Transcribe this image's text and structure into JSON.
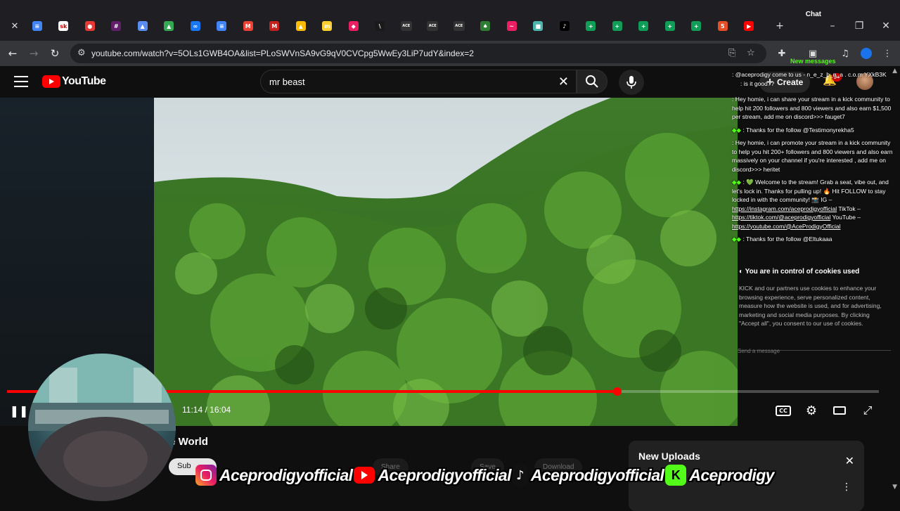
{
  "browser": {
    "chat_label": "Chat",
    "new_messages": "New messages",
    "url": "youtube.com/watch?v=5OLs1GWB4OA&list=PLoSWVnSA9vG9qV0CVCpg5WwEy3LiP7udY&index=2",
    "tabs": [
      {
        "icon": "docs-icon",
        "color": "#4285f4",
        "glyph": "≡"
      },
      {
        "icon": "sk-icon",
        "color": "#ffffff",
        "glyph": "sk"
      },
      {
        "icon": "red-circle-icon",
        "color": "#e53935",
        "glyph": "●"
      },
      {
        "icon": "slack-icon",
        "color": "#611f69",
        "glyph": "#"
      },
      {
        "icon": "triangle-icon",
        "color": "#5b8def",
        "glyph": "▲"
      },
      {
        "icon": "drive-icon",
        "color": "#34a853",
        "glyph": "▲"
      },
      {
        "icon": "meta-icon",
        "color": "#1877f2",
        "glyph": "∞"
      },
      {
        "icon": "docs-icon",
        "color": "#4285f4",
        "glyph": "≡"
      },
      {
        "icon": "gmail-icon",
        "color": "#ea4335",
        "glyph": "M"
      },
      {
        "icon": "gmail-icon",
        "color": "#c5221f",
        "glyph": "M"
      },
      {
        "icon": "multicolor-icon",
        "color": "#fbbc05",
        "glyph": "▲"
      },
      {
        "icon": "miro-icon",
        "color": "#ffd02f",
        "glyph": "m"
      },
      {
        "icon": "pink-icon",
        "color": "#e91e63",
        "glyph": "◆"
      },
      {
        "icon": "vercel-icon",
        "color": "#1a1a1a",
        "glyph": "\\"
      },
      {
        "icon": "ace-icon",
        "color": "#333333",
        "glyph": "ACE"
      },
      {
        "icon": "ace-icon",
        "color": "#333333",
        "glyph": "ACE"
      },
      {
        "icon": "ace-icon",
        "color": "#333333",
        "glyph": "ACE"
      },
      {
        "icon": "leaf-icon",
        "color": "#2e7d32",
        "glyph": "♠"
      },
      {
        "icon": "wave-icon",
        "color": "#e91e63",
        "glyph": "~"
      },
      {
        "icon": "photo-icon",
        "color": "#4db6ac",
        "glyph": "■"
      },
      {
        "icon": "tiktok-icon",
        "color": "#000000",
        "glyph": "♪"
      },
      {
        "icon": "sheets-icon",
        "color": "#0f9d58",
        "glyph": "+"
      },
      {
        "icon": "sheets-icon",
        "color": "#0f9d58",
        "glyph": "+"
      },
      {
        "icon": "sheets-icon",
        "color": "#0f9d58",
        "glyph": "+"
      },
      {
        "icon": "sheets-icon",
        "color": "#0f9d58",
        "glyph": "+"
      },
      {
        "icon": "sheets-icon",
        "color": "#0f9d58",
        "glyph": "+"
      },
      {
        "icon": "html5-icon",
        "color": "#e34f26",
        "glyph": "5"
      },
      {
        "icon": "youtube-icon",
        "color": "#ff0000",
        "glyph": "▶"
      }
    ]
  },
  "youtube": {
    "logo_text": "YouTube",
    "search_value": "mr beast",
    "create_label": "Create",
    "notif_count": "9+"
  },
  "player": {
    "time": "11:14 / 16:04",
    "progress_fraction": 0.7
  },
  "chat": {
    "messages": [
      {
        "text": ": @aceprodigy come to us - n_e_z_b_n_a . c.o.m YXkB3K"
      },
      {
        "text": ": is it good??"
      },
      {
        "text": ": Hey homie, i can share your stream in a kick community to help hit 200 followers and 800 viewers and also earn $1,500 per stream, add me on discord>>> fauget7"
      },
      {
        "text": ": Thanks for the follow @Testimonyrekha5"
      },
      {
        "text": ": Hey homie, i can promote your stream in a kick community to help you hit 200+ followers and 800 viewers and also earn massively on your channel if you're interested , add me on discord>>> heritet"
      },
      {
        "text": ": 💚 Welcome to the stream! Grab a seat, vibe out, and let's lock in. Thanks for pulling up! 🔥 Hit FOLLOW to stay locked in with the community! 📸 IG –"
      },
      {
        "text": ": Thanks for the follow @Eltukaaa"
      }
    ],
    "links": {
      "ig": "https://instagram.com/aceprodigyofficial",
      "tiktok_label": "TikTok –",
      "tiktok": "https://tiktok.com/@aceprodigyofficial",
      "youtube_label": "YouTube –",
      "youtube": "https://youtube.com/@AceProdigyOfficial"
    },
    "cookies_title": "You are in control of cookies used",
    "cookies_body": "KICK and our partners use cookies to enhance your browsing experience, serve personalized content, measure how the website is used, and for advertising, marketing and social media purposes. By clicking \"Accept all\", you consent to our use of cookies.",
    "send_placeholder": "Send a message"
  },
  "below": {
    "title_fragment": "he World",
    "subscribe_label": "Sub",
    "pills": [
      "Share",
      "Save",
      "Download"
    ],
    "new_uploads": "New Uploads"
  },
  "banner": {
    "handles": [
      "Aceprodigyofficial",
      "Aceprodigyofficial",
      "Aceprodigyofficial",
      "Aceprodigy"
    ]
  }
}
